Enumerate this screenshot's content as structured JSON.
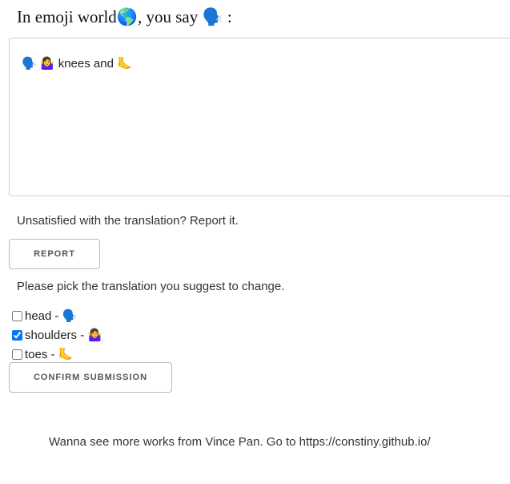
{
  "heading": "In emoji world🌎, you say 🗣️ :",
  "translation_output": "🗣️ 🤷‍♀️ knees and 🦶",
  "report": {
    "prompt": "Unsatisfied with the translation? Report it.",
    "button_label": "REPORT"
  },
  "pick": {
    "prompt": "Please pick the translation you suggest to change.",
    "options": [
      {
        "label": "head - 🗣️",
        "checked": false
      },
      {
        "label": "shoulders - 🤷‍♀️",
        "checked": true
      },
      {
        "label": "toes - 🦶",
        "checked": false
      }
    ],
    "confirm_label": "CONFIRM SUBMISSION"
  },
  "footer": "Wanna see more works from Vince Pan. Go to https://constiny.github.io/"
}
